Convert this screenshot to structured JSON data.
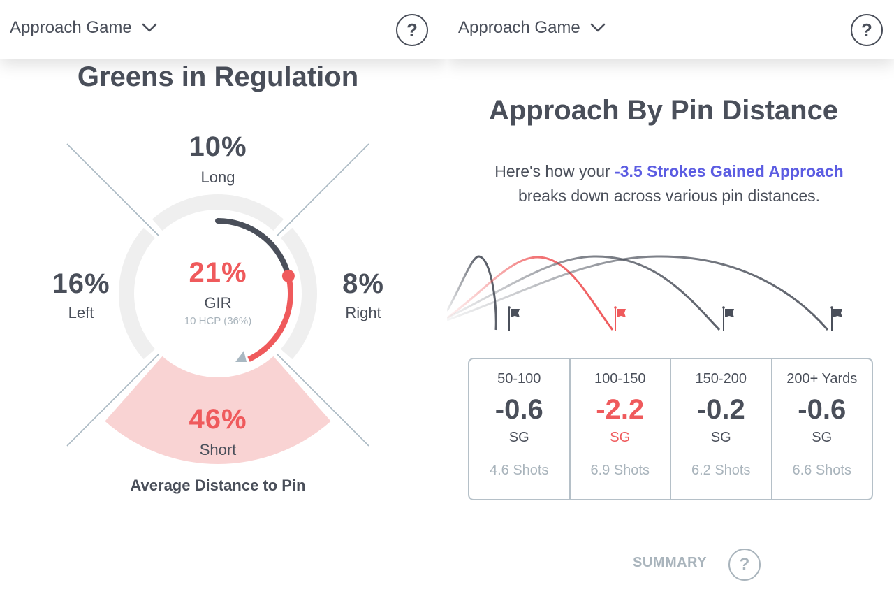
{
  "left_panel": {
    "header": {
      "title": "Approach Game",
      "dropdown_icon": "chevron-down-icon",
      "help_icon": "help-circle-icon",
      "help_label": "?"
    },
    "title": "Greens in Regulation",
    "gir": {
      "value": "21%",
      "label": "GIR",
      "benchmark": "10 HCP (36%)",
      "gir_fraction": 0.21,
      "benchmark_fraction": 0.36
    },
    "misses": {
      "long": {
        "value": "10%",
        "label": "Long"
      },
      "left": {
        "value": "16%",
        "label": "Left"
      },
      "right": {
        "value": "8%",
        "label": "Right"
      },
      "short": {
        "value": "46%",
        "label": "Short"
      }
    },
    "highlighted_miss": "short",
    "footer": "Average Distance to Pin"
  },
  "right_panel": {
    "header": {
      "title": "Approach Game",
      "dropdown_icon": "chevron-down-icon",
      "help_icon": "help-circle-icon",
      "help_label": "?"
    },
    "title": "Approach By Pin Distance",
    "intro_before": "Here's how your ",
    "intro_highlight": "-3.5 Strokes Gained Approach",
    "intro_after": "breaks down across various pin distances.",
    "distances": [
      {
        "range": "50-100",
        "sg": "-0.6",
        "sg_label": "SG",
        "shots": "4.6 Shots",
        "highlight": false
      },
      {
        "range": "100-150",
        "sg": "-2.2",
        "sg_label": "SG",
        "shots": "6.9 Shots",
        "highlight": true
      },
      {
        "range": "150-200",
        "sg": "-0.2",
        "sg_label": "SG",
        "shots": "6.2 Shots",
        "highlight": false
      },
      {
        "range": "200+ Yards",
        "sg": "-0.6",
        "sg_label": "SG",
        "shots": "6.6 Shots",
        "highlight": false
      }
    ],
    "summary_label": "SUMMARY",
    "summary_help_label": "?"
  },
  "colors": {
    "text": "#4a4f5a",
    "accent_red": "#ef5a5c",
    "accent_pink": "#f9d3d3",
    "accent_blue": "#5b5ce2",
    "muted": "#a9b4bc",
    "ring_bg": "#efefef",
    "divider": "#b5c0c8"
  }
}
